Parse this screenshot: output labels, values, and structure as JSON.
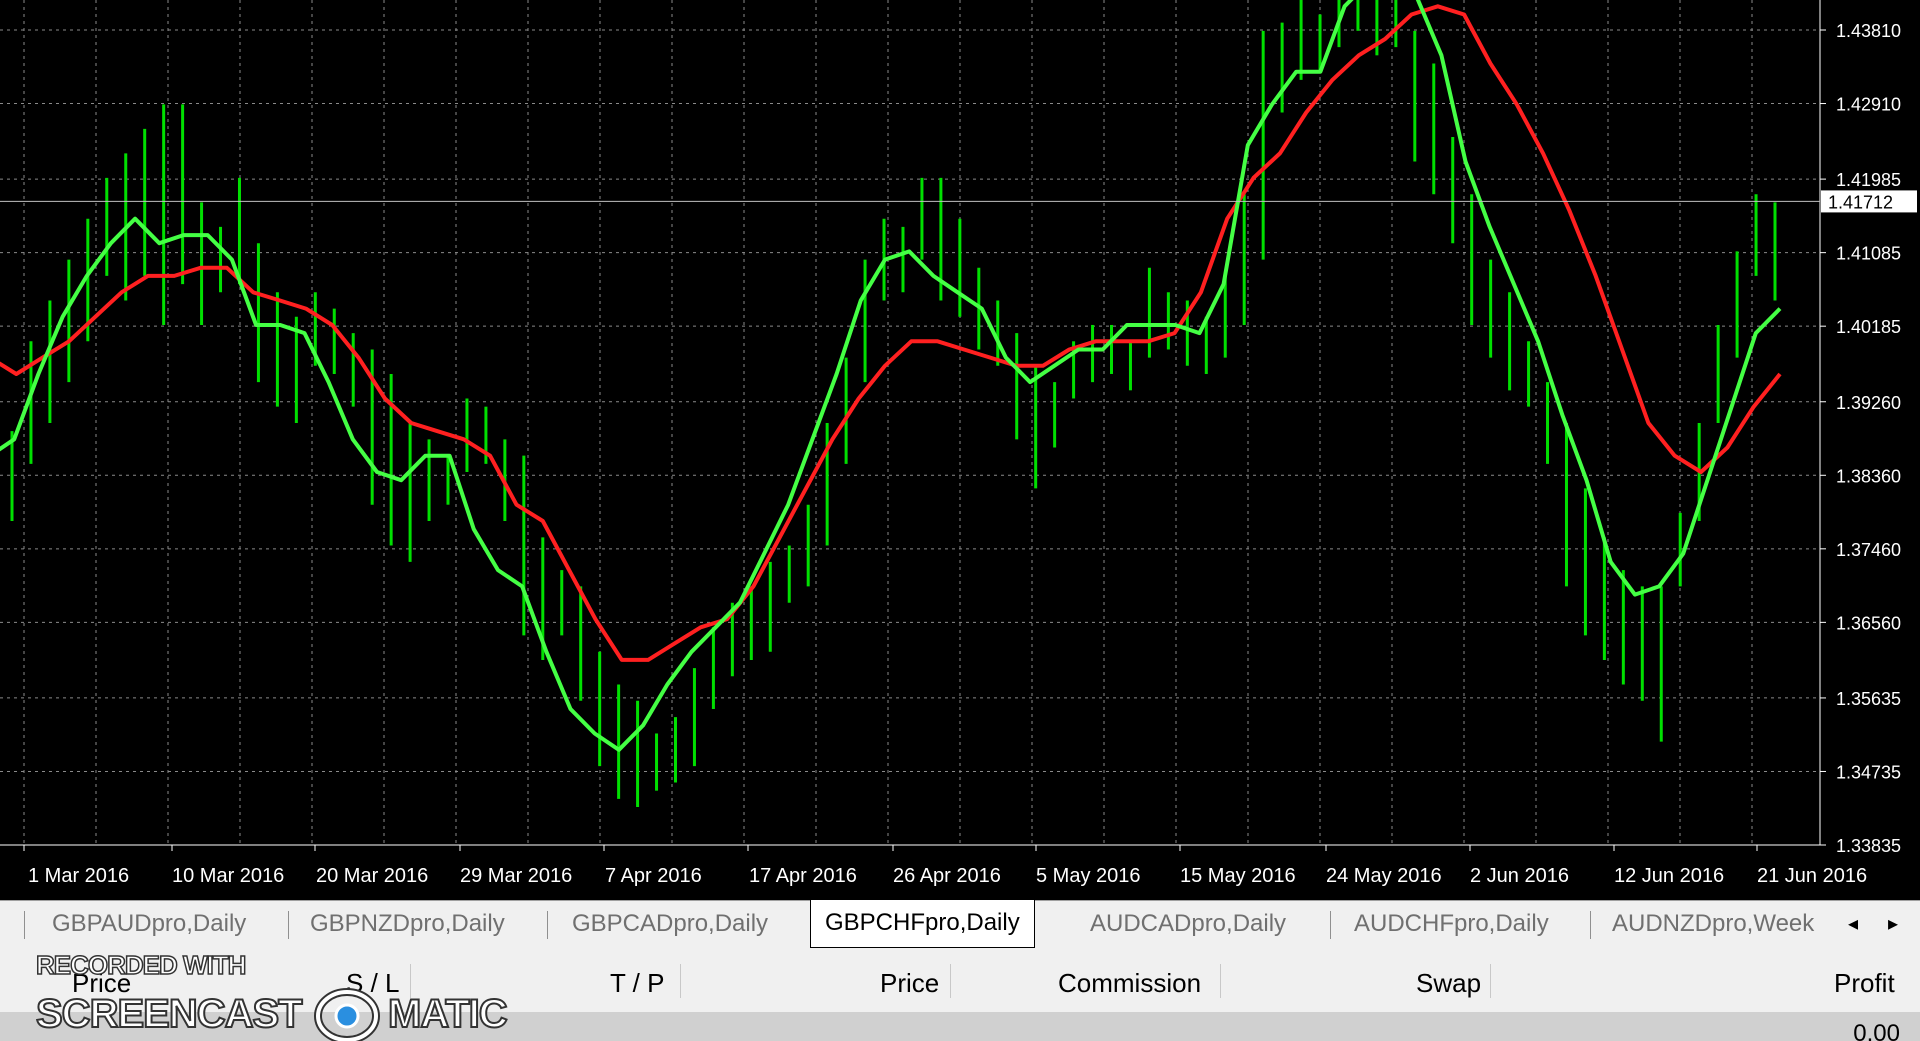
{
  "chart": {
    "current_price": "1.41712",
    "price_line_value": 1.41712,
    "colors": {
      "background": "#000000",
      "grid": "#8a8a8a",
      "bars": "#00e000",
      "fast_ma": "#44ff44",
      "slow_ma": "#ff2020",
      "axis_text": "#ffffff"
    }
  },
  "chart_data": {
    "type": "line",
    "symbol": "GBPCHF",
    "timeframe": "Daily",
    "y_ticks": [
      "1.43810",
      "1.42910",
      "1.41985",
      "1.41085",
      "1.40185",
      "1.39260",
      "1.38360",
      "1.37460",
      "1.36560",
      "1.35635",
      "1.34735",
      "1.33835"
    ],
    "ylim": [
      1.33835,
      1.4381
    ],
    "x_ticks": [
      "1 Mar 2016",
      "10 Mar 2016",
      "20 Mar 2016",
      "29 Mar 2016",
      "7 Apr 2016",
      "17 Apr 2016",
      "26 Apr 2016",
      "5 May 2016",
      "15 May 2016",
      "24 May 2016",
      "2 Jun 2016",
      "12 Jun 2016",
      "21 Jun 2016"
    ],
    "bars_high_low": [
      [
        1.389,
        1.378
      ],
      [
        1.4,
        1.385
      ],
      [
        1.405,
        1.39
      ],
      [
        1.41,
        1.395
      ],
      [
        1.415,
        1.4
      ],
      [
        1.42,
        1.408
      ],
      [
        1.423,
        1.405
      ],
      [
        1.426,
        1.408
      ],
      [
        1.429,
        1.402
      ],
      [
        1.429,
        1.407
      ],
      [
        1.417,
        1.402
      ],
      [
        1.414,
        1.406
      ],
      [
        1.42,
        1.407
      ],
      [
        1.412,
        1.395
      ],
      [
        1.406,
        1.392
      ],
      [
        1.403,
        1.39
      ],
      [
        1.406,
        1.397
      ],
      [
        1.404,
        1.396
      ],
      [
        1.401,
        1.392
      ],
      [
        1.399,
        1.38
      ],
      [
        1.396,
        1.375
      ],
      [
        1.39,
        1.373
      ],
      [
        1.388,
        1.378
      ],
      [
        1.386,
        1.38
      ],
      [
        1.393,
        1.384
      ],
      [
        1.392,
        1.385
      ],
      [
        1.388,
        1.378
      ],
      [
        1.386,
        1.364
      ],
      [
        1.376,
        1.361
      ],
      [
        1.372,
        1.364
      ],
      [
        1.37,
        1.356
      ],
      [
        1.362,
        1.348
      ],
      [
        1.358,
        1.344
      ],
      [
        1.356,
        1.343
      ],
      [
        1.352,
        1.345
      ],
      [
        1.354,
        1.346
      ],
      [
        1.36,
        1.348
      ],
      [
        1.365,
        1.355
      ],
      [
        1.368,
        1.359
      ],
      [
        1.37,
        1.361
      ],
      [
        1.373,
        1.362
      ],
      [
        1.375,
        1.368
      ],
      [
        1.38,
        1.37
      ],
      [
        1.39,
        1.375
      ],
      [
        1.398,
        1.385
      ],
      [
        1.41,
        1.395
      ],
      [
        1.415,
        1.405
      ],
      [
        1.414,
        1.406
      ],
      [
        1.42,
        1.41
      ],
      [
        1.42,
        1.405
      ],
      [
        1.415,
        1.403
      ],
      [
        1.409,
        1.399
      ],
      [
        1.405,
        1.397
      ],
      [
        1.401,
        1.388
      ],
      [
        1.397,
        1.382
      ],
      [
        1.395,
        1.387
      ],
      [
        1.4,
        1.393
      ],
      [
        1.402,
        1.395
      ],
      [
        1.402,
        1.396
      ],
      [
        1.4,
        1.394
      ],
      [
        1.409,
        1.398
      ],
      [
        1.406,
        1.399
      ],
      [
        1.405,
        1.397
      ],
      [
        1.403,
        1.396
      ],
      [
        1.408,
        1.398
      ],
      [
        1.418,
        1.402
      ],
      [
        1.438,
        1.41
      ],
      [
        1.439,
        1.428
      ],
      [
        1.442,
        1.432
      ],
      [
        1.44,
        1.433
      ],
      [
        1.446,
        1.436
      ],
      [
        1.444,
        1.438
      ],
      [
        1.442,
        1.435
      ],
      [
        1.444,
        1.436
      ],
      [
        1.438,
        1.422
      ],
      [
        1.434,
        1.418
      ],
      [
        1.425,
        1.412
      ],
      [
        1.418,
        1.402
      ],
      [
        1.41,
        1.398
      ],
      [
        1.406,
        1.394
      ],
      [
        1.4,
        1.392
      ],
      [
        1.395,
        1.385
      ],
      [
        1.39,
        1.37
      ],
      [
        1.382,
        1.364
      ],
      [
        1.376,
        1.361
      ],
      [
        1.372,
        1.358
      ],
      [
        1.37,
        1.356
      ],
      [
        1.37,
        1.351
      ],
      [
        1.379,
        1.37
      ],
      [
        1.39,
        1.378
      ],
      [
        1.402,
        1.39
      ],
      [
        1.411,
        1.398
      ],
      [
        1.418,
        1.408
      ],
      [
        1.417,
        1.405
      ]
    ],
    "fast_ma": [
      1.386,
      1.388,
      1.396,
      1.403,
      1.408,
      1.412,
      1.415,
      1.412,
      1.413,
      1.413,
      1.41,
      1.402,
      1.402,
      1.401,
      1.395,
      1.388,
      1.384,
      1.383,
      1.386,
      1.386,
      1.377,
      1.372,
      1.37,
      1.362,
      1.355,
      1.352,
      1.35,
      1.353,
      1.358,
      1.362,
      1.365,
      1.368,
      1.374,
      1.38,
      1.388,
      1.396,
      1.405,
      1.41,
      1.411,
      1.408,
      1.406,
      1.404,
      1.398,
      1.395,
      1.397,
      1.399,
      1.399,
      1.402,
      1.402,
      1.402,
      1.401,
      1.407,
      1.424,
      1.429,
      1.433,
      1.433,
      1.441,
      1.444,
      1.446,
      1.442,
      1.435,
      1.422,
      1.414,
      1.407,
      1.4,
      1.391,
      1.383,
      1.373,
      1.369,
      1.37,
      1.374,
      1.383,
      1.392,
      1.401,
      1.404
    ],
    "slow_ma": [
      1.398,
      1.396,
      1.398,
      1.4,
      1.403,
      1.406,
      1.408,
      1.408,
      1.409,
      1.409,
      1.406,
      1.405,
      1.404,
      1.402,
      1.398,
      1.393,
      1.39,
      1.389,
      1.388,
      1.386,
      1.38,
      1.378,
      1.372,
      1.366,
      1.361,
      1.361,
      1.363,
      1.365,
      1.366,
      1.37,
      1.376,
      1.382,
      1.388,
      1.393,
      1.397,
      1.4,
      1.4,
      1.399,
      1.398,
      1.397,
      1.397,
      1.399,
      1.4,
      1.4,
      1.4,
      1.401,
      1.406,
      1.415,
      1.42,
      1.423,
      1.428,
      1.432,
      1.435,
      1.437,
      1.44,
      1.441,
      1.44,
      1.434,
      1.429,
      1.423,
      1.416,
      1.408,
      1.399,
      1.39,
      1.386,
      1.384,
      1.387,
      1.392,
      1.396
    ]
  },
  "tabs": [
    {
      "label": "GBPAUDpro,Daily",
      "active": false
    },
    {
      "label": "GBPNZDpro,Daily",
      "active": false
    },
    {
      "label": "GBPCADpro,Daily",
      "active": false
    },
    {
      "label": "GBPCHFpro,Daily",
      "active": true
    },
    {
      "label": "AUDCADpro,Daily",
      "active": false
    },
    {
      "label": "AUDCHFpro,Daily",
      "active": false
    },
    {
      "label": "AUDNZDpro,Week",
      "active": false
    }
  ],
  "tab_scroll": {
    "left": "◂",
    "right": "▸"
  },
  "terminal": {
    "columns": [
      "Price",
      "S / L",
      "T / P",
      "Price",
      "Commission",
      "Swap",
      "Profit"
    ],
    "profit_value": "0.00"
  },
  "watermark": {
    "line1": "RECORDED WITH",
    "word_left": "SCREENCAST",
    "word_right": "MATIC"
  }
}
